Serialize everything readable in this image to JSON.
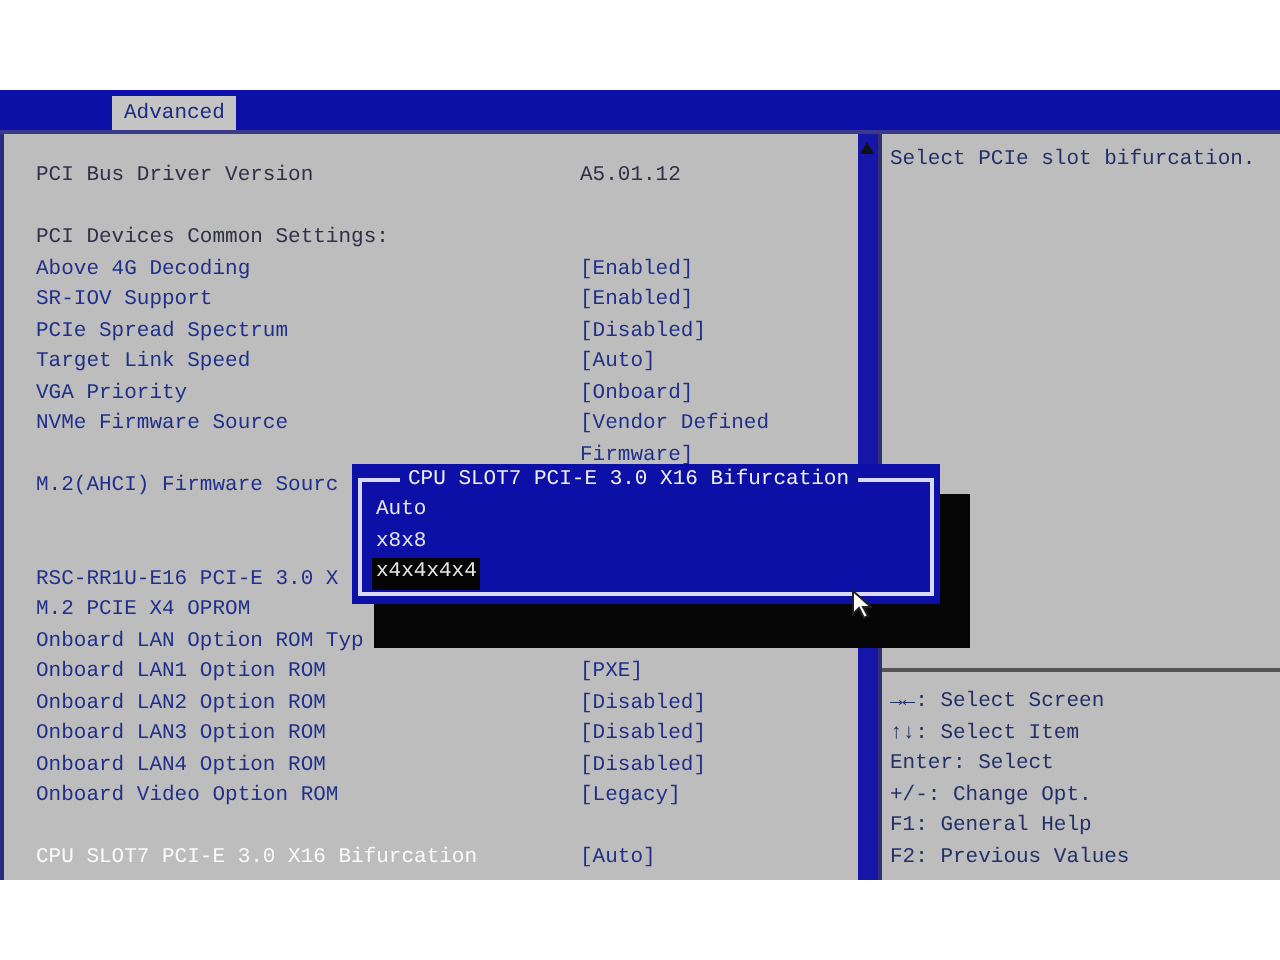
{
  "menu_bar": {
    "tabs": [
      {
        "label": "Advanced",
        "selected": true
      }
    ]
  },
  "settings": {
    "groups": [
      [
        {
          "kind": "info",
          "label": "PCI Bus Driver Version",
          "value": "A5.01.12"
        }
      ],
      [
        {
          "kind": "heading",
          "label": "PCI Devices Common Settings:"
        },
        {
          "kind": "setting",
          "label": "Above 4G Decoding",
          "value": "[Enabled]",
          "selected": false
        },
        {
          "kind": "setting",
          "label": "SR-IOV Support",
          "value": "[Enabled]",
          "selected": false
        },
        {
          "kind": "setting",
          "label": "PCIe Spread Spectrum",
          "value": "[Disabled]",
          "selected": false
        },
        {
          "kind": "setting",
          "label": "Target Link Speed",
          "value": "[Auto]",
          "selected": false
        },
        {
          "kind": "setting",
          "label": "VGA Priority",
          "value": "[Onboard]",
          "selected": false
        },
        {
          "kind": "setting",
          "label": "NVMe Firmware Source",
          "value": "[Vendor Defined Firmware]",
          "selected": false
        },
        {
          "kind": "setting",
          "label": "M.2(AHCI) Firmware Sourc",
          "selected": false
        }
      ],
      [
        {
          "kind": "setting",
          "label": "RSC-RR1U-E16 PCI-E 3.0 X",
          "selected": false
        },
        {
          "kind": "setting",
          "label": "M.2 PCIE X4 OPROM",
          "selected": false
        },
        {
          "kind": "setting",
          "label": "Onboard LAN Option ROM Typ",
          "selected": false
        },
        {
          "kind": "setting",
          "label": "Onboard LAN1 Option ROM",
          "value": "[PXE]",
          "selected": false
        },
        {
          "kind": "setting",
          "label": "Onboard LAN2 Option ROM",
          "value": "[Disabled]",
          "selected": false
        },
        {
          "kind": "setting",
          "label": "Onboard LAN3 Option ROM",
          "value": "[Disabled]",
          "selected": false
        },
        {
          "kind": "setting",
          "label": "Onboard LAN4 Option ROM",
          "value": "[Disabled]",
          "selected": false
        },
        {
          "kind": "setting",
          "label": "Onboard Video Option ROM",
          "value": "[Legacy]",
          "selected": false
        }
      ],
      [
        {
          "kind": "setting",
          "label": "CPU SLOT7 PCI-E 3.0 X16 Bifurcation",
          "value": "[Auto]",
          "selected": true
        }
      ]
    ]
  },
  "popup": {
    "title": "CPU SLOT7 PCI-E 3.0 X16 Bifurcation",
    "options": [
      {
        "label": "Auto",
        "selected": false
      },
      {
        "label": "x8x8",
        "selected": false
      },
      {
        "label": "x4x4x4x4",
        "selected": true
      }
    ]
  },
  "help": {
    "text": "Select PCIe slot bifurcation.",
    "keys": [
      "→←: Select Screen",
      "↑↓: Select Item",
      "Enter: Select",
      "+/-: Change Opt.",
      "F1: General Help",
      "F2: Previous Values"
    ]
  }
}
